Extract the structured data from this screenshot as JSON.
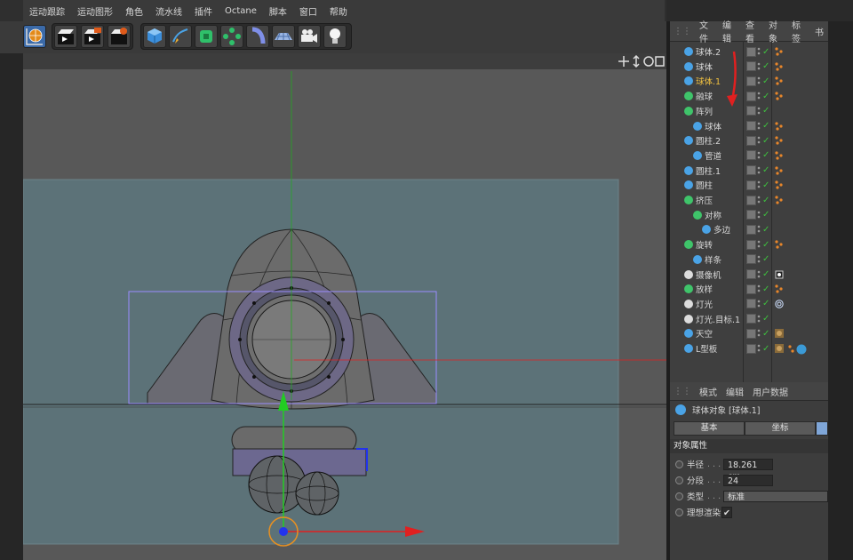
{
  "menubar": {
    "items": [
      "运动跟踪",
      "运动图形",
      "角色",
      "流水线",
      "插件",
      "Octane",
      "脚本",
      "窗口",
      "帮助"
    ]
  },
  "toolbar": {
    "icons": [
      "coordinate-system-icon",
      "render-view-icon",
      "render-to-picture-viewer-icon",
      "render-settings-icon",
      "cube-icon",
      "pen-icon",
      "subdivision-icon",
      "array-icon",
      "deformer-icon",
      "floor-icon",
      "camera-icon",
      "light-icon"
    ]
  },
  "object_manager": {
    "menu": [
      "文件",
      "编辑",
      "查看",
      "对象",
      "标签",
      "书"
    ],
    "objects": [
      {
        "name": "球体.2",
        "icon": "sphere-icon",
        "color": "#4aa3e6",
        "indent": 0,
        "tag": "phong-tag-icon"
      },
      {
        "name": "球体",
        "icon": "sphere-icon",
        "color": "#4aa3e6",
        "indent": 0,
        "tag": "phong-tag-icon"
      },
      {
        "name": "球体.1",
        "icon": "sphere-icon",
        "color": "#4aa3e6",
        "indent": 0,
        "tag": "phong-tag-icon",
        "selected": true
      },
      {
        "name": "融球",
        "icon": "metaball-icon",
        "color": "#3fc46a",
        "indent": 0,
        "tag": "phong-tag-icon"
      },
      {
        "name": "阵列",
        "icon": "array-icon",
        "color": "#3fc46a",
        "indent": 0,
        "tag": ""
      },
      {
        "name": "球体",
        "icon": "sphere-icon",
        "color": "#4aa3e6",
        "indent": 1,
        "tag": "phong-tag-icon"
      },
      {
        "name": "圆柱.2",
        "icon": "cylinder-icon",
        "color": "#4aa3e6",
        "indent": 0,
        "tag": "phong-tag-icon"
      },
      {
        "name": "管道",
        "icon": "tube-icon",
        "color": "#4aa3e6",
        "indent": 1,
        "tag": "phong-tag-icon"
      },
      {
        "name": "圆柱.1",
        "icon": "cylinder-icon",
        "color": "#4aa3e6",
        "indent": 0,
        "tag": "phong-tag-icon"
      },
      {
        "name": "圆柱",
        "icon": "cylinder-icon",
        "color": "#4aa3e6",
        "indent": 0,
        "tag": "phong-tag-icon"
      },
      {
        "name": "挤压",
        "icon": "extrude-icon",
        "color": "#3fc46a",
        "indent": 0,
        "tag": "phong-tag-icon"
      },
      {
        "name": "对称",
        "icon": "symmetry-icon",
        "color": "#3fc46a",
        "indent": 1,
        "tag": ""
      },
      {
        "name": "多边",
        "icon": "polygon-spline-icon",
        "color": "#4aa3e6",
        "indent": 2,
        "tag": ""
      },
      {
        "name": "旋转",
        "icon": "lathe-icon",
        "color": "#3fc46a",
        "indent": 0,
        "tag": "phong-tag-icon"
      },
      {
        "name": "样条",
        "icon": "spline-icon",
        "color": "#4aa3e6",
        "indent": 1,
        "tag": ""
      },
      {
        "name": "摄像机",
        "icon": "camera-icon",
        "color": "#dddddd",
        "indent": 0,
        "tag": "camera-target-tag-icon"
      },
      {
        "name": "放样",
        "icon": "loft-icon",
        "color": "#3fc46a",
        "indent": 0,
        "tag": "phong-tag-icon"
      },
      {
        "name": "灯光",
        "icon": "light-icon",
        "color": "#dddddd",
        "indent": 0,
        "tag": "target-tag-icon"
      },
      {
        "name": "灯光.目标.1",
        "icon": "null-icon",
        "color": "#dddddd",
        "indent": 0,
        "tag": ""
      },
      {
        "name": "天空",
        "icon": "sky-icon",
        "color": "#4aa3e6",
        "indent": 0,
        "tag": "material-tag-icon"
      },
      {
        "name": "L型板",
        "icon": "cube-icon",
        "color": "#4aa3e6",
        "indent": 0,
        "tag": "material-tag-icon"
      }
    ]
  },
  "attribute_manager": {
    "menu": [
      "模式",
      "编辑",
      "用户数据"
    ],
    "title": "球体对象 [球体.1]",
    "tabs": [
      "基本",
      "坐标"
    ],
    "section": "对象属性",
    "props": [
      {
        "label": "半径",
        "value": "18.261 cm"
      },
      {
        "label": "分段",
        "value": "24"
      },
      {
        "label": "类型",
        "value": "标准"
      },
      {
        "label": "理想渲染",
        "value": "✔"
      }
    ]
  },
  "colors": {
    "selected_text": "#f0c040",
    "check": "#3fbf3f",
    "axis_y": "#22cc22",
    "axis_x": "#e02020",
    "axis_z": "#2233ee",
    "selection_box": "#9a8cff"
  }
}
